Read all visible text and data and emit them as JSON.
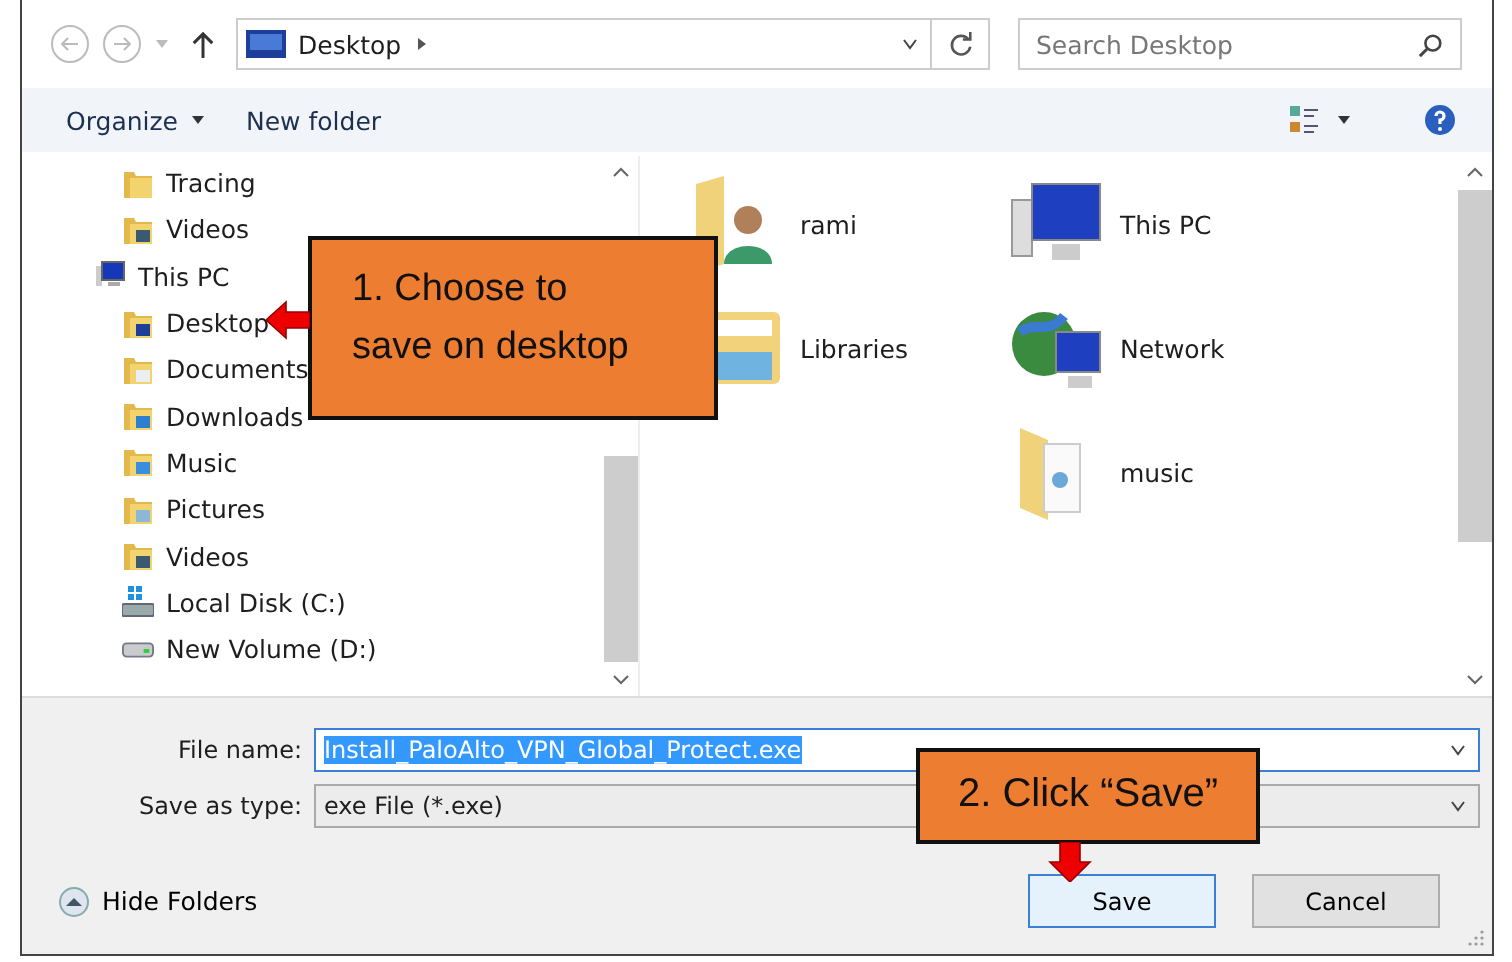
{
  "address": {
    "location": "Desktop",
    "search_placeholder": "Search Desktop"
  },
  "toolbar": {
    "organize": "Organize",
    "new_folder": "New folder"
  },
  "nav": {
    "continued_items": [
      {
        "label": "Tracing",
        "kind": "folder"
      },
      {
        "label": "Videos",
        "kind": "video-folder"
      }
    ],
    "items": [
      {
        "label": "This PC",
        "kind": "computer",
        "children": [
          {
            "label": "Desktop",
            "kind": "desktop-folder"
          },
          {
            "label": "Documents",
            "kind": "doc-folder"
          },
          {
            "label": "Downloads",
            "kind": "download-folder"
          },
          {
            "label": "Music",
            "kind": "music-folder"
          },
          {
            "label": "Pictures",
            "kind": "picture-folder"
          },
          {
            "label": "Videos",
            "kind": "video-folder"
          },
          {
            "label": "Local Disk (C:)",
            "kind": "system-drive"
          },
          {
            "label": "New Volume (D:)",
            "kind": "drive"
          }
        ]
      }
    ]
  },
  "content": {
    "columns": [
      [
        {
          "label": "rami",
          "kind": "user"
        },
        {
          "label": "Libraries",
          "kind": "libraries"
        }
      ],
      [
        {
          "label": "This PC",
          "kind": "computer"
        },
        {
          "label": "Network",
          "kind": "network"
        },
        {
          "label": "music",
          "kind": "folder"
        }
      ]
    ]
  },
  "form": {
    "file_name_label": "File name:",
    "file_name": "Install_PaloAlto_VPN_Global_Protect.exe",
    "file_name_selected": true,
    "type_label": "Save as type:",
    "type_value": "exe File (*.exe)"
  },
  "footer": {
    "hide_folders": "Hide Folders",
    "save": "Save",
    "cancel": "Cancel"
  },
  "callouts": [
    {
      "text": "1. Choose to save on desktop",
      "kind": "left"
    },
    {
      "text": "2. Click “Save”",
      "kind": "down"
    }
  ]
}
